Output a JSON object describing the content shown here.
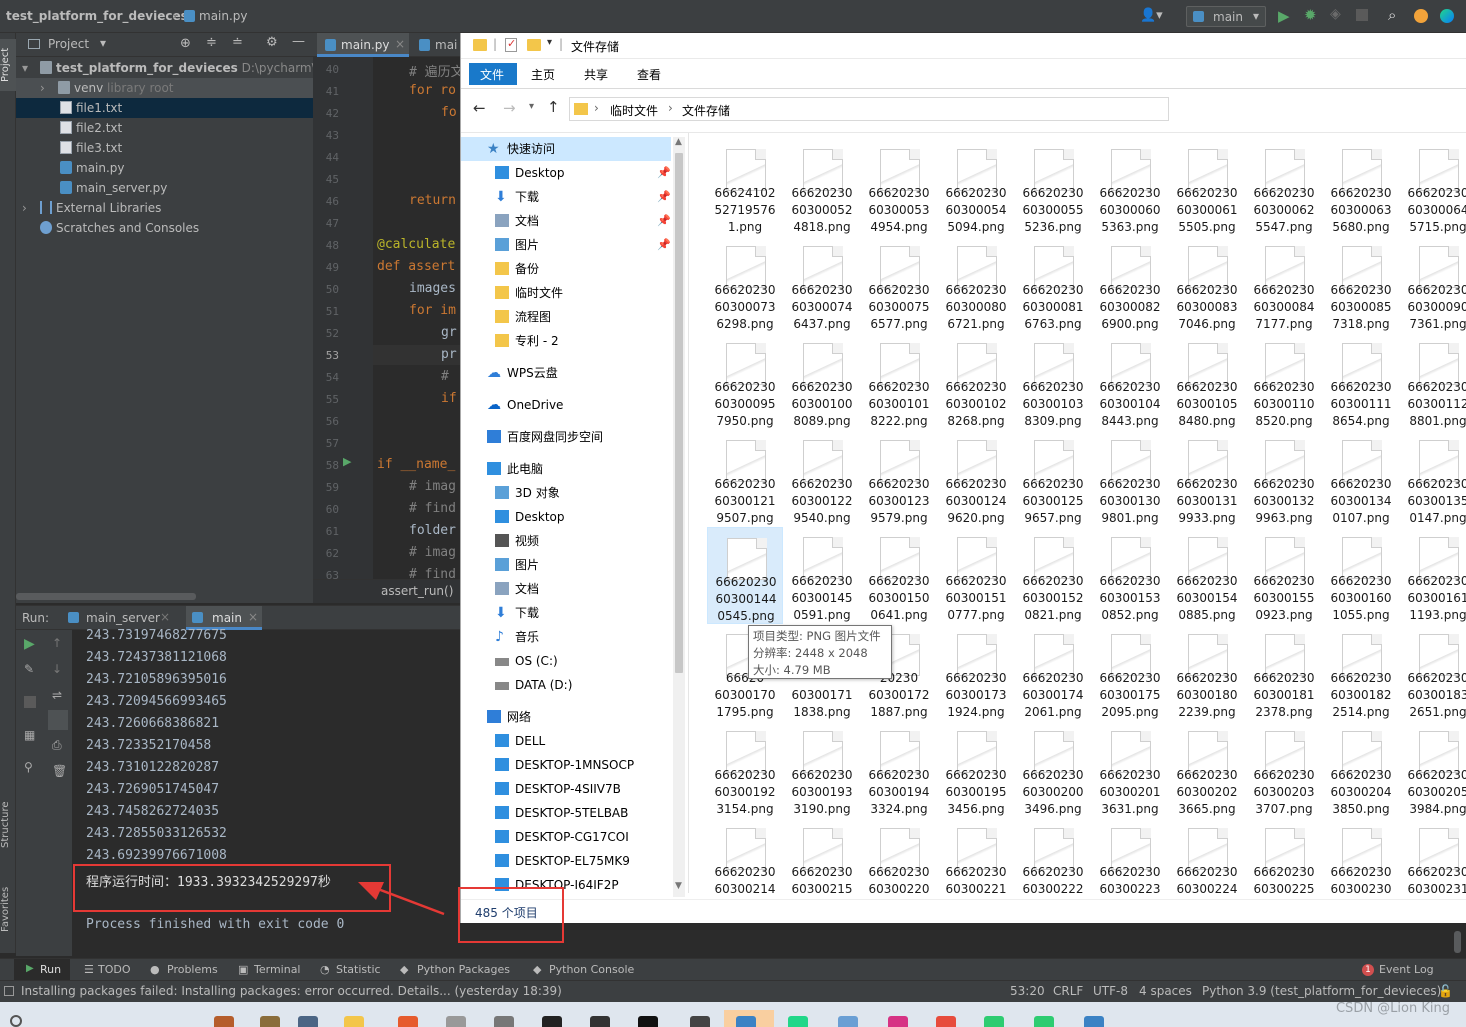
{
  "ide": {
    "project_name": "test_platform_for_devieces",
    "file_crumb": "main.py",
    "branch": "main",
    "project_tool_label": "Project",
    "project_panel_title": "Project",
    "tree": [
      {
        "label": "test_platform_for_devieces",
        "hint": "D:\\pycharm\\Pr",
        "level": 0,
        "kind": "dir"
      },
      {
        "label": "venv",
        "hint": "library root",
        "level": 1,
        "kind": "dir"
      },
      {
        "label": "file1.txt",
        "hint": "",
        "level": 2,
        "kind": "txt"
      },
      {
        "label": "file2.txt",
        "hint": "",
        "level": 2,
        "kind": "txt"
      },
      {
        "label": "file3.txt",
        "hint": "",
        "level": 2,
        "kind": "txt"
      },
      {
        "label": "main.py",
        "hint": "",
        "level": 2,
        "kind": "py"
      },
      {
        "label": "main_server.py",
        "hint": "",
        "level": 2,
        "kind": "py"
      },
      {
        "label": "External Libraries",
        "hint": "",
        "level": 0,
        "kind": "lib"
      },
      {
        "label": "Scratches and Consoles",
        "hint": "",
        "level": 0,
        "kind": "scratch"
      }
    ],
    "editor_tabs": [
      "main.py",
      "mai"
    ],
    "line_numbers": [
      "40",
      "41",
      "42",
      "43",
      "44",
      "45",
      "46",
      "47",
      "48",
      "49",
      "50",
      "51",
      "52",
      "53",
      "54",
      "55",
      "56",
      "57",
      "58",
      "59",
      "60",
      "61",
      "62",
      "63"
    ],
    "code_lines": [
      "# 遍历文",
      "for ro",
      "fo",
      "",
      "",
      "",
      "return",
      "",
      "@calculate",
      "def assert",
      "images",
      "for im",
      "gr",
      "pr",
      "# ",
      "if",
      "",
      "",
      "if __name_",
      "# imag",
      "# find",
      "folder",
      "# imag",
      "# find"
    ],
    "breadcrumb_fn": "assert_run()",
    "run_label": "Run:",
    "run_tabs": [
      "main_server",
      "main"
    ],
    "output_lines": [
      "243.73197468277675",
      "243.72437381121068",
      "243.72105896395016",
      "243.72094566993465",
      "243.7260668386821",
      "243.723352170458",
      "243.7310122820287",
      "243.7269051745047",
      "243.7458262724035",
      "243.72855033126532",
      "243.69239976671008"
    ],
    "runtime_line": "程序运行时间：1933.3932342529297秒",
    "exit_line": "Process finished with exit code 0",
    "structure_label": "Structure",
    "favorites_label": "Favorites",
    "bottom_tabs": [
      "Run",
      "TODO",
      "Problems",
      "Terminal",
      "Statistic",
      "Python Packages",
      "Python Console"
    ],
    "event_log": "Event Log",
    "event_count": "1",
    "status_message": "Installing packages failed: Installing packages: error occurred. Details... (yesterday 18:39)",
    "status_items": [
      "53:20",
      "CRLF",
      "UTF-8",
      "4 spaces",
      "Python 3.9 (test_platform_for_devieces)"
    ]
  },
  "explorer": {
    "title": "文件存储",
    "ribbon_tabs": [
      "文件",
      "主页",
      "共享",
      "查看"
    ],
    "path": [
      "临时文件",
      "文件存储"
    ],
    "nav": [
      {
        "label": "快速访问",
        "icon": "star-icon",
        "pin": false,
        "active": true
      },
      {
        "label": "Desktop",
        "icon": "desktop-icon",
        "pin": true
      },
      {
        "label": "下载",
        "icon": "download-icon",
        "pin": true
      },
      {
        "label": "文档",
        "icon": "document-icon",
        "pin": true
      },
      {
        "label": "图片",
        "icon": "picture-icon",
        "pin": true
      },
      {
        "label": "备份",
        "icon": "folder-icon",
        "pin": false
      },
      {
        "label": "临时文件",
        "icon": "folder-icon",
        "pin": false
      },
      {
        "label": "流程图",
        "icon": "folder-icon",
        "pin": false
      },
      {
        "label": "专利 - 2",
        "icon": "folder-icon",
        "pin": false
      },
      {
        "label": "WPS云盘",
        "icon": "cloud-icon",
        "pin": false,
        "gap": true
      },
      {
        "label": "OneDrive",
        "icon": "onedrive-icon",
        "pin": false,
        "gap": true
      },
      {
        "label": "百度网盘同步空间",
        "icon": "baidu-icon",
        "pin": false,
        "gap": true
      },
      {
        "label": "此电脑",
        "icon": "pc-icon",
        "pin": false,
        "gap": true
      },
      {
        "label": "3D 对象",
        "icon": "3d-icon",
        "pin": false
      },
      {
        "label": "Desktop",
        "icon": "desktop-icon",
        "pin": false
      },
      {
        "label": "视频",
        "icon": "video-icon",
        "pin": false
      },
      {
        "label": "图片",
        "icon": "picture-icon",
        "pin": false
      },
      {
        "label": "文档",
        "icon": "document-icon",
        "pin": false
      },
      {
        "label": "下载",
        "icon": "download-icon",
        "pin": false
      },
      {
        "label": "音乐",
        "icon": "music-icon",
        "pin": false
      },
      {
        "label": "OS (C:)",
        "icon": "drive-icon",
        "pin": false
      },
      {
        "label": "DATA (D:)",
        "icon": "drive-icon",
        "pin": false
      },
      {
        "label": "网络",
        "icon": "network-icon",
        "pin": false,
        "gap": true
      },
      {
        "label": "DELL",
        "icon": "computer-icon",
        "pin": false
      },
      {
        "label": "DESKTOP-1MNSOCP",
        "icon": "computer-icon",
        "pin": false
      },
      {
        "label": "DESKTOP-4SIIV7B",
        "icon": "computer-icon",
        "pin": false
      },
      {
        "label": "DESKTOP-5TELBAB",
        "icon": "computer-icon",
        "pin": false
      },
      {
        "label": "DESKTOP-CG17COI",
        "icon": "computer-icon",
        "pin": false
      },
      {
        "label": "DESKTOP-EL75MK9",
        "icon": "computer-icon",
        "pin": false
      },
      {
        "label": "DESKTOP-I64IF2P",
        "icon": "computer-icon",
        "pin": false
      }
    ],
    "files": [
      [
        "66624102",
        "52719576",
        "1.png"
      ],
      [
        "66620230",
        "60300052",
        "4818.png"
      ],
      [
        "66620230",
        "60300053",
        "4954.png"
      ],
      [
        "66620230",
        "60300054",
        "5094.png"
      ],
      [
        "66620230",
        "60300055",
        "5236.png"
      ],
      [
        "66620230",
        "60300060",
        "5363.png"
      ],
      [
        "66620230",
        "60300061",
        "5505.png"
      ],
      [
        "66620230",
        "60300062",
        "5547.png"
      ],
      [
        "66620230",
        "60300063",
        "5680.png"
      ],
      [
        "66620230",
        "60300064",
        "5715.png"
      ],
      [
        "66620230",
        "60300073",
        "6298.png"
      ],
      [
        "66620230",
        "60300074",
        "6437.png"
      ],
      [
        "66620230",
        "60300075",
        "6577.png"
      ],
      [
        "66620230",
        "60300080",
        "6721.png"
      ],
      [
        "66620230",
        "60300081",
        "6763.png"
      ],
      [
        "66620230",
        "60300082",
        "6900.png"
      ],
      [
        "66620230",
        "60300083",
        "7046.png"
      ],
      [
        "66620230",
        "60300084",
        "7177.png"
      ],
      [
        "66620230",
        "60300085",
        "7318.png"
      ],
      [
        "66620230",
        "60300090",
        "7361.png"
      ],
      [
        "66620230",
        "60300095",
        "7950.png"
      ],
      [
        "66620230",
        "60300100",
        "8089.png"
      ],
      [
        "66620230",
        "60300101",
        "8222.png"
      ],
      [
        "66620230",
        "60300102",
        "8268.png"
      ],
      [
        "66620230",
        "60300103",
        "8309.png"
      ],
      [
        "66620230",
        "60300104",
        "8443.png"
      ],
      [
        "66620230",
        "60300105",
        "8480.png"
      ],
      [
        "66620230",
        "60300110",
        "8520.png"
      ],
      [
        "66620230",
        "60300111",
        "8654.png"
      ],
      [
        "66620230",
        "60300112",
        "8801.png"
      ],
      [
        "66620230",
        "60300121",
        "9507.png"
      ],
      [
        "66620230",
        "60300122",
        "9540.png"
      ],
      [
        "66620230",
        "60300123",
        "9579.png"
      ],
      [
        "66620230",
        "60300124",
        "9620.png"
      ],
      [
        "66620230",
        "60300125",
        "9657.png"
      ],
      [
        "66620230",
        "60300130",
        "9801.png"
      ],
      [
        "66620230",
        "60300131",
        "9933.png"
      ],
      [
        "66620230",
        "60300132",
        "9963.png"
      ],
      [
        "66620230",
        "60300134",
        "0107.png"
      ],
      [
        "66620230",
        "60300135",
        "0147.png"
      ],
      [
        "66620230",
        "60300144",
        "0545.png"
      ],
      [
        "66620230",
        "60300145",
        "0591.png"
      ],
      [
        "66620230",
        "60300150",
        "0641.png"
      ],
      [
        "66620230",
        "60300151",
        "0777.png"
      ],
      [
        "66620230",
        "60300152",
        "0821.png"
      ],
      [
        "66620230",
        "60300153",
        "0852.png"
      ],
      [
        "66620230",
        "60300154",
        "0885.png"
      ],
      [
        "66620230",
        "60300155",
        "0923.png"
      ],
      [
        "66620230",
        "60300160",
        "1055.png"
      ],
      [
        "66620230",
        "60300161",
        "1193.png"
      ],
      [
        "66620",
        "60300170",
        "1795.png"
      ],
      [
        "",
        "60300171",
        "1838.png"
      ],
      [
        "20230",
        "60300172",
        "1887.png"
      ],
      [
        "66620230",
        "60300173",
        "1924.png"
      ],
      [
        "66620230",
        "60300174",
        "2061.png"
      ],
      [
        "66620230",
        "60300175",
        "2095.png"
      ],
      [
        "66620230",
        "60300180",
        "2239.png"
      ],
      [
        "66620230",
        "60300181",
        "2378.png"
      ],
      [
        "66620230",
        "60300182",
        "2514.png"
      ],
      [
        "66620230",
        "60300183",
        "2651.png"
      ],
      [
        "66620230",
        "60300192",
        "3154.png"
      ],
      [
        "66620230",
        "60300193",
        "3190.png"
      ],
      [
        "66620230",
        "60300194",
        "3324.png"
      ],
      [
        "66620230",
        "60300195",
        "3456.png"
      ],
      [
        "66620230",
        "60300200",
        "3496.png"
      ],
      [
        "66620230",
        "60300201",
        "3631.png"
      ],
      [
        "66620230",
        "60300202",
        "3665.png"
      ],
      [
        "66620230",
        "60300203",
        "3707.png"
      ],
      [
        "66620230",
        "60300204",
        "3850.png"
      ],
      [
        "66620230",
        "60300205",
        "3984.png"
      ],
      [
        "66620230",
        "60300214",
        ""
      ],
      [
        "66620230",
        "60300215",
        ""
      ],
      [
        "66620230",
        "60300220",
        ""
      ],
      [
        "66620230",
        "60300221",
        ""
      ],
      [
        "66620230",
        "60300222",
        ""
      ],
      [
        "66620230",
        "60300223",
        ""
      ],
      [
        "66620230",
        "60300224",
        ""
      ],
      [
        "66620230",
        "60300225",
        ""
      ],
      [
        "66620230",
        "60300230",
        ""
      ],
      [
        "66620230",
        "60300231",
        ""
      ]
    ],
    "tooltip": [
      "项目类型: PNG 图片文件",
      "分辨率: 2448 x 2048",
      "大小: 4.79 MB"
    ],
    "item_count": "485 个项目"
  },
  "watermark": "CSDN @Lion King",
  "colors": {
    "accent_blue": "#1979ca",
    "highlight_red": "#e53935",
    "ide_bg": "#2b2b2b",
    "ide_panel": "#3c3f41"
  }
}
